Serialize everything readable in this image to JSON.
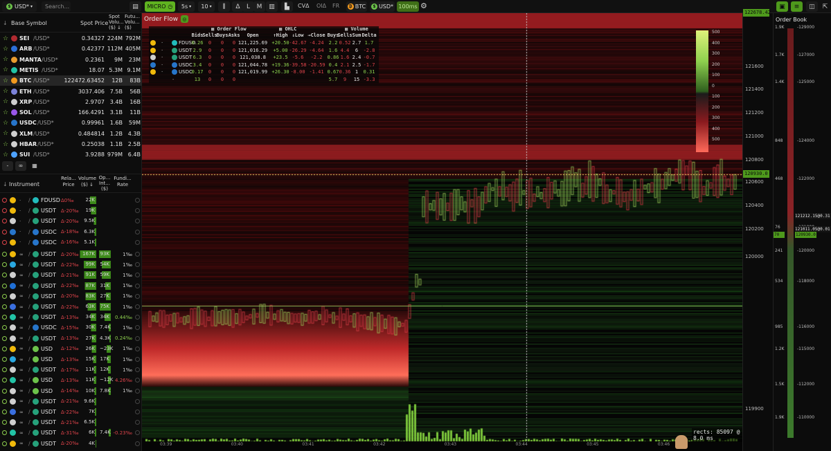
{
  "toolbar": {
    "quote": "USD*",
    "search_placeholder": "Search...",
    "mode": "MICRO",
    "interval": "5s",
    "depth": "10",
    "btns": [
      "Δ",
      "L",
      "M"
    ],
    "cvd": "CVΔ",
    "oid": "OIΔ",
    "fr": "FR",
    "btc_chip": "BTC",
    "usd_chip": "USD*",
    "ms": "100ms"
  },
  "spot": {
    "headers": {
      "symbol": "Base Symbol",
      "price": "Spot Price",
      "spotvol": "Spot Volu... ($) ↓",
      "futvol": "Futu... Volu... ($)"
    },
    "rows": [
      {
        "sym": "SEI",
        "q": "/USD*",
        "price": "0.34327",
        "sv": "224M",
        "fv": "792M",
        "c": "#b02a30",
        "fav": "☆"
      },
      {
        "sym": "ARB",
        "q": "/USD*",
        "price": "0.42377",
        "sv": "112M",
        "fv": "405M",
        "c": "#2d6fd6",
        "fav": "☆"
      },
      {
        "sym": "MANTA",
        "q": "/USD*",
        "price": "0.2361",
        "sv": "9M",
        "fv": "23M",
        "c": "#e79b2f",
        "fav": "☆"
      },
      {
        "sym": "METIS",
        "q": "/USD*",
        "price": "18.07",
        "sv": "5.3M",
        "fv": "9.1M",
        "c": "#22c3a6",
        "fav": "☆"
      },
      {
        "sym": "BTC",
        "q": "/USD*",
        "price": "122472.63452",
        "sv": "12B",
        "fv": "83B",
        "c": "#f29a1f",
        "fav": "☆",
        "sel": true
      },
      {
        "sym": "ETH",
        "q": "/USD*",
        "price": "3037.406",
        "sv": "7.5B",
        "fv": "56B",
        "c": "#7b82d8",
        "fav": "☆"
      },
      {
        "sym": "XRP",
        "q": "/USD*",
        "price": "2.9707",
        "sv": "3.4B",
        "fv": "16B",
        "c": "#cfcfcf",
        "fav": "☆"
      },
      {
        "sym": "SOL",
        "q": "/USD*",
        "price": "166.4291",
        "sv": "3.1B",
        "fv": "11B",
        "c": "#9a57e8",
        "fav": "☆"
      },
      {
        "sym": "USDC",
        "q": "/USD*",
        "price": "0.99961",
        "sv": "1.6B",
        "fv": "59M",
        "c": "#2775ca",
        "fav": "☆"
      },
      {
        "sym": "XLM",
        "q": "/USD*",
        "price": "0.484814",
        "sv": "1.2B",
        "fv": "4.3B",
        "c": "#cfcfcf",
        "fav": "☆"
      },
      {
        "sym": "HBAR",
        "q": "/USD*",
        "price": "0.25038",
        "sv": "1.1B",
        "fv": "2.5B",
        "c": "#cfcfcf",
        "fav": "☆"
      },
      {
        "sym": "SUI",
        "q": "/USD*",
        "price": "3.9288",
        "sv": "979M",
        "fv": "6.4B",
        "c": "#4da2ff",
        "fav": "☆"
      }
    ]
  },
  "instruments": {
    "headers": {
      "inst": "Instrument",
      "rel": "Rela... Price",
      "vol": "Volume ($) ↓",
      "oi": "Op... Int... ($)",
      "fund": "Fundi... Rate"
    },
    "rows": [
      {
        "q": "FDUSD",
        "rel": "Δ0‰",
        "vol": "22K",
        "volw": 10,
        "oi": "",
        "fund": "",
        "c": "#e0444b",
        "ex": "#f0b90b",
        "tq": "#2bb"
      },
      {
        "q": "USDT",
        "rel": "Δ-20‰",
        "vol": "19K",
        "volw": 8,
        "oi": "",
        "fund": "",
        "c": "#e0444b",
        "ex": "#f0b90b",
        "tq": "#26a17b"
      },
      {
        "q": "USDT",
        "rel": "Δ-20‰",
        "vol": "9.5K",
        "volw": 4,
        "oi": "",
        "fund": "",
        "c": "#e0444b",
        "ex": "#cfcfcf",
        "tq": "#26a17b"
      },
      {
        "q": "USDC",
        "rel": "Δ-18‰",
        "vol": "6.3K",
        "volw": 3,
        "oi": "",
        "fund": "",
        "c": "#e0444b",
        "ex": "#2775ca",
        "tq": "#2775ca"
      },
      {
        "q": "USDC",
        "rel": "Δ-16‰",
        "vol": "5.1K",
        "volw": 2,
        "oi": "",
        "fund": "",
        "c": "#e0444b",
        "ex": "#f0b90b",
        "tq": "#2775ca"
      },
      {
        "q": "USDT",
        "rel": "Δ-20‰",
        "vol": "167K",
        "volw": 26,
        "oi": "93K",
        "oiw": 17,
        "fund": "1‰",
        "c": "#8fd14f",
        "ex": "#f0b90b",
        "tq": "#26a17b"
      },
      {
        "q": "USDT",
        "rel": "Δ-22‰",
        "vol": "99K",
        "volw": 20,
        "oi": "54K",
        "oiw": 13,
        "fund": "1‰",
        "c": "#8fd14f",
        "ex": "#2aa8e0",
        "tq": "#26a17b"
      },
      {
        "q": "USDT",
        "rel": "Δ-21‰",
        "vol": "91K",
        "volw": 19,
        "oi": "59K",
        "oiw": 13,
        "fund": "1‰",
        "c": "#8fd14f",
        "ex": "#cfcfcf",
        "tq": "#26a17b"
      },
      {
        "q": "USDT",
        "rel": "Δ-22‰",
        "vol": "87K",
        "volw": 18,
        "oi": "31K",
        "oiw": 8,
        "fund": "1‰",
        "c": "#8fd14f",
        "ex": "#1f6fd6",
        "tq": "#26a17b"
      },
      {
        "q": "USDT",
        "rel": "Δ-20‰",
        "vol": "83K",
        "volw": 17,
        "oi": "27K",
        "oiw": 7,
        "fund": "1‰",
        "c": "#8fd14f",
        "ex": "#cfcfcf",
        "tq": "#26a17b"
      },
      {
        "q": "USDT",
        "rel": "Δ-22‰",
        "vol": "63K",
        "volw": 14,
        "oi": "75K",
        "oiw": 16,
        "fund": "1‰",
        "c": "#8fd14f",
        "ex": "#3a6fe0",
        "tq": "#26a17b"
      },
      {
        "q": "USDT",
        "rel": "Δ-13‰",
        "vol": "34K",
        "volw": 9,
        "oi": "34K",
        "oiw": 9,
        "fund": "0.44‰",
        "c": "#8fd14f",
        "ex": "#22c3a6",
        "tq": "#26a17b"
      },
      {
        "q": "USDC",
        "rel": "Δ-15‰",
        "vol": "30K",
        "volw": 8,
        "oi": "7.4K",
        "oiw": 3,
        "fund": "1‰",
        "c": "#8fd14f",
        "ex": "#cfcfcf",
        "tq": "#2775ca"
      },
      {
        "q": "USDT",
        "rel": "Δ-13‰",
        "vol": "27K",
        "volw": 7,
        "oi": "4.3K",
        "oiw": 2,
        "fund": "0.24‰",
        "c": "#8fd14f",
        "ex": "#cfcfcf",
        "tq": "#26a17b"
      },
      {
        "q": "USD",
        "rel": "Δ-12‰",
        "vol": "26K",
        "volw": 7,
        "oi": "~23K",
        "oiw": 6,
        "fund": "1‰",
        "c": "#8fd14f",
        "ex": "#f0b90b",
        "tq": "#6cc24a"
      },
      {
        "q": "USD",
        "rel": "Δ-13‰",
        "vol": "15K",
        "volw": 5,
        "oi": "17K",
        "oiw": 5,
        "fund": "1‰",
        "c": "#8fd14f",
        "ex": "#2aa8e0",
        "tq": "#6cc24a"
      },
      {
        "q": "USDT",
        "rel": "Δ-17‰",
        "vol": "11K",
        "volw": 4,
        "oi": "12K",
        "oiw": 4,
        "fund": "1‰",
        "c": "#8fd14f",
        "ex": "#cfcfcf",
        "tq": "#26a17b"
      },
      {
        "q": "USD",
        "rel": "Δ-13‰",
        "vol": "11K",
        "volw": 4,
        "oi": "~12K",
        "oiw": 4,
        "fund": "4.26‰",
        "c": "#8fd14f",
        "ex": "#22c3a6",
        "tq": "#6cc24a"
      },
      {
        "q": "USD",
        "rel": "Δ-14‰",
        "vol": "10K",
        "volw": 3,
        "oi": "7.8K",
        "oiw": 3,
        "fund": "1‰",
        "c": "#8fd14f",
        "ex": "#cfcfcf",
        "tq": "#6cc24a"
      },
      {
        "q": "USDT",
        "rel": "Δ-21‰",
        "vol": "9.6K",
        "volw": 3,
        "oi": "",
        "fund": "",
        "c": "#8fd14f",
        "ex": "#cfcfcf",
        "tq": "#26a17b"
      },
      {
        "q": "USDT",
        "rel": "Δ-22‰",
        "vol": "7K",
        "volw": 2,
        "oi": "",
        "fund": "",
        "c": "#8fd14f",
        "ex": "#3a6fe0",
        "tq": "#26a17b"
      },
      {
        "q": "USDT",
        "rel": "Δ-21‰",
        "vol": "6.5K",
        "volw": 2,
        "oi": "",
        "fund": "",
        "c": "#8fd14f",
        "ex": "#cfcfcf",
        "tq": "#26a17b"
      },
      {
        "q": "USDT",
        "rel": "Δ-31‰",
        "vol": "6K",
        "volw": 2,
        "oi": "7.4K",
        "oiw": 3,
        "fund": "-0.23‰",
        "c": "#8fd14f",
        "ex": "#22c3a6",
        "tq": "#26a17b"
      },
      {
        "q": "USDT",
        "rel": "Δ-20‰",
        "vol": "4K",
        "volw": 1,
        "oi": "",
        "fund": "",
        "c": "#8fd14f",
        "ex": "#f0b90b",
        "tq": "#26a17b"
      }
    ]
  },
  "orderflow": {
    "title": "Order Flow",
    "group_of": "Order Flow",
    "group_ohlc": "OHLC",
    "group_vol": "Volume",
    "cols": [
      "Bids",
      "Sells",
      "Buys",
      "Asks",
      "Open",
      "↑High",
      "↓Low",
      "→Close",
      "Buys",
      "Sells",
      "Sum",
      "Delta"
    ],
    "rows": [
      {
        "q": "FDUSD",
        "v": [
          "0.26",
          "0",
          "0",
          "0",
          "121,225.69",
          "+20.50",
          "-42.67",
          "-4.24",
          "2.2",
          "0.52",
          "2.7",
          "1.7"
        ],
        "ex": "#f0b90b",
        "tq": "#2bb"
      },
      {
        "q": "USDT",
        "v": [
          "2.9",
          "0",
          "0",
          "0",
          "121,016.29",
          "+5.00",
          "-26.29",
          "-4.64",
          "1.6",
          "4.4",
          "6",
          "-2.8"
        ],
        "ex": "#f0b90b",
        "tq": "#26a17b"
      },
      {
        "q": "USDT",
        "v": [
          "6.3",
          "0",
          "0",
          "0",
          "121,038.8",
          "+23.5",
          "-5.6",
          "-2.2",
          "0.86",
          "1.6",
          "2.4",
          "-0.7"
        ],
        "ex": "#cfcfcf",
        "tq": "#26a17b"
      },
      {
        "q": "USDC",
        "v": [
          "3.4",
          "0",
          "0",
          "0",
          "121,044.78",
          "+19.36",
          "-39.58",
          "-20.59",
          "0.4",
          "2.1",
          "2.5",
          "-1.7"
        ],
        "ex": "#2775ca",
        "tq": "#2775ca"
      },
      {
        "q": "USDC",
        "v": [
          "0.17",
          "0",
          "0",
          "0",
          "121,019.99",
          "+26.30",
          "-8.00",
          "-1.41",
          "0.67",
          "0.36",
          "1",
          "0.31"
        ],
        "ex": "#f0b90b",
        "tq": "#2775ca"
      }
    ],
    "total": [
      "13",
      "0",
      "0",
      "0",
      "",
      "",
      "",
      "",
      "5.7",
      "9",
      "15",
      "-3.3"
    ]
  },
  "scale_labels": [
    "500",
    "400",
    "300",
    "200",
    "100",
    "0",
    "100",
    "200",
    "300",
    "400",
    "500"
  ],
  "price_axis": [
    "121600",
    "121400",
    "121200",
    "121000",
    "120800",
    "120600",
    "120400",
    "120200",
    "120000",
    "119900"
  ],
  "price_top": "122678.42",
  "price_cur": "120930.0",
  "time_axis": [
    "03:39",
    "03:40",
    "03:41",
    "03:42",
    "03:43",
    "03:44",
    "03:45",
    "03:46"
  ],
  "rects_status": "rects: 85097 @ 8.0 ms",
  "book": {
    "title": "Order Book",
    "levels": [
      {
        "qty": "1.9K",
        "price": "-129000"
      },
      {
        "qty": "1.7K",
        "price": "-127000"
      },
      {
        "qty": "1.4K",
        "price": "-125000"
      },
      {
        "qty": "848",
        "price": "-124000"
      },
      {
        "qty": "468",
        "price": "-122000"
      },
      {
        "qty": "76",
        "price": "-121000"
      },
      {
        "qty": "241",
        "price": "-120000"
      },
      {
        "qty": "534",
        "price": "-118000"
      },
      {
        "qty": "985",
        "price": "-116000"
      },
      {
        "qty": "1.2K",
        "price": "-115000"
      },
      {
        "qty": "1.5K",
        "price": "-112000"
      },
      {
        "qty": "1.9K",
        "price": "-110000"
      }
    ],
    "tag1": "121212.15@0.31",
    "tag2": "121011.05@0.01",
    "cur_qty": "70",
    "cur_price": "120930.0"
  },
  "colors": {
    "accent": "#5fb320",
    "bid": "#8fd14f",
    "ask": "#e0444b"
  }
}
